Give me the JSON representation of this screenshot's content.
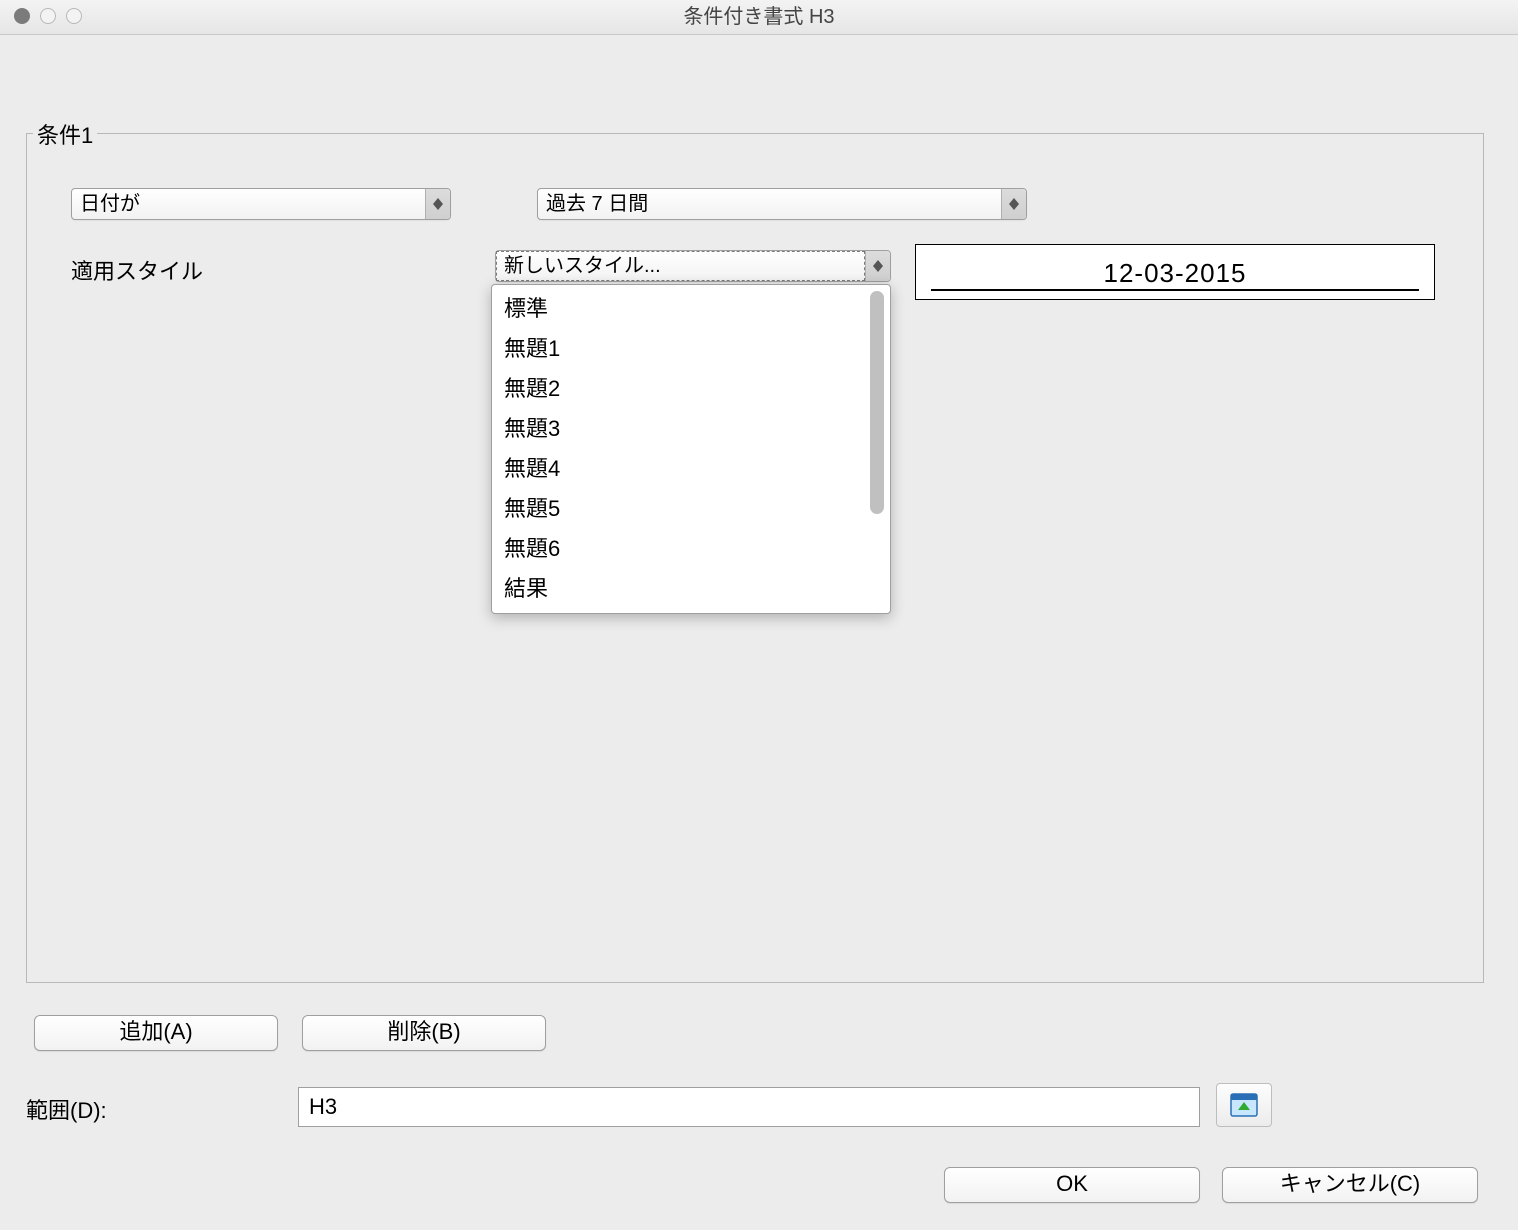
{
  "window": {
    "title": "条件付き書式 H3"
  },
  "panel": {
    "legend": "条件1"
  },
  "condition": {
    "type_label": "日付が",
    "value_label": "過去 7 日間"
  },
  "style": {
    "label": "適用スタイル",
    "selected": "新しいスタイル...",
    "options": [
      "標準",
      "無題1",
      "無題2",
      "無題3",
      "無題4",
      "無題5",
      "無題6",
      "結果"
    ],
    "preview": "12-03-2015"
  },
  "buttons": {
    "add": "追加(A)",
    "delete": "削除(B)",
    "ok": "OK",
    "cancel": "キャンセル(C)"
  },
  "range": {
    "label": "範囲(D):",
    "value": "H3"
  }
}
